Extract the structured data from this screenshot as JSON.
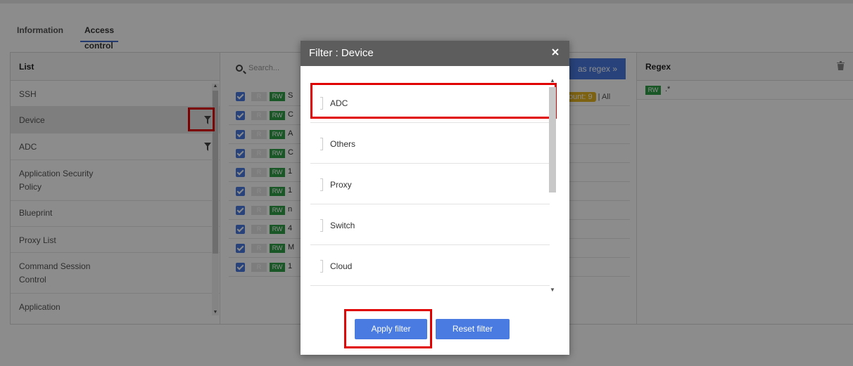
{
  "tabs": [
    {
      "label": "Information"
    },
    {
      "label": "Access control"
    }
  ],
  "list_panel": {
    "header": "List",
    "items": [
      {
        "label": "SSH"
      },
      {
        "label": "Device"
      },
      {
        "label": "ADC"
      },
      {
        "label": "Application Security",
        "label2": "Policy"
      },
      {
        "label": "Blueprint"
      },
      {
        "label": "Proxy List"
      },
      {
        "label": "Command Session",
        "label2": "Control"
      },
      {
        "label": "Application"
      }
    ]
  },
  "middle_panel": {
    "search_placeholder": "Search...",
    "regex_button": "as regex »",
    "count_text": "ount: 9",
    "all_text": "| All",
    "rows": [
      {
        "r": "R",
        "rw": "RW",
        "name": "S"
      },
      {
        "r": "R",
        "rw": "RW",
        "name": "C"
      },
      {
        "r": "R",
        "rw": "RW",
        "name": "A"
      },
      {
        "r": "R",
        "rw": "RW",
        "name": "C"
      },
      {
        "r": "R",
        "rw": "RW",
        "name": "1"
      },
      {
        "r": "R",
        "rw": "RW",
        "name": "1"
      },
      {
        "r": "R",
        "rw": "RW",
        "name": "n"
      },
      {
        "r": "R",
        "rw": "RW",
        "name": "4"
      },
      {
        "r": "R",
        "rw": "RW",
        "name": "M"
      },
      {
        "r": "R",
        "rw": "RW",
        "name": "1"
      }
    ]
  },
  "regex_panel": {
    "header": "Regex",
    "rows": [
      {
        "rw": "RW",
        "value": ".*"
      }
    ]
  },
  "modal": {
    "title": "Filter : Device",
    "options": [
      {
        "label": "ADC"
      },
      {
        "label": "Others"
      },
      {
        "label": "Proxy"
      },
      {
        "label": "Switch"
      },
      {
        "label": "Cloud"
      }
    ],
    "apply_label": "Apply filter",
    "reset_label": "Reset filter"
  },
  "colors": {
    "accent": "#4a7be0",
    "highlight": "#e10000",
    "rw_tag": "#2ea045",
    "count_badge": "#e4b222",
    "modal_header": "#5d5d5d"
  }
}
